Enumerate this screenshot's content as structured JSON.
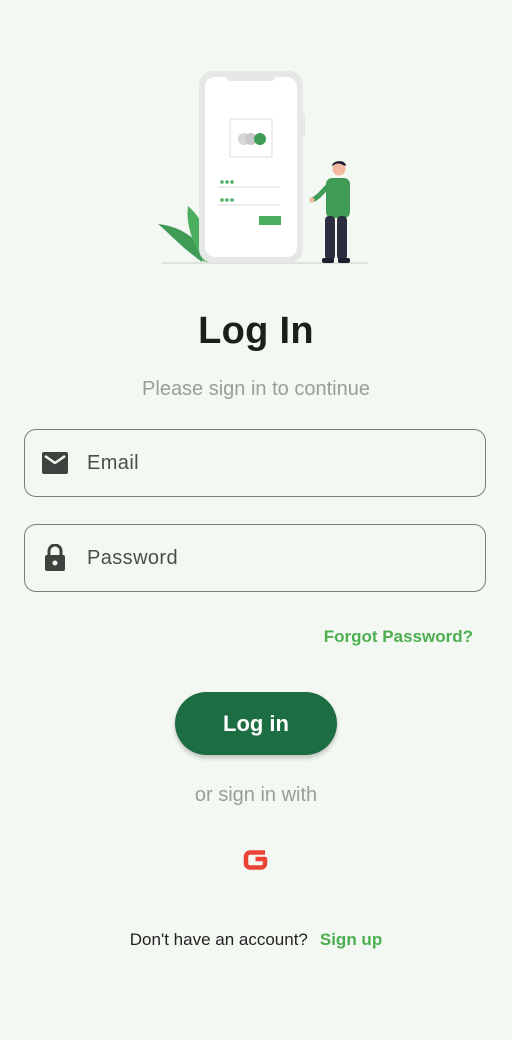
{
  "header": {
    "title": "Log In",
    "subtitle": "Please sign in to continue"
  },
  "form": {
    "email": {
      "placeholder": "Email",
      "value": "",
      "icon": "mail-icon"
    },
    "password": {
      "placeholder": "Password",
      "value": "",
      "icon": "lock-icon"
    },
    "forgot_label": "Forgot Password?",
    "login_label": "Log in"
  },
  "social": {
    "label": "or sign in with",
    "providers": [
      {
        "name": "google-icon"
      }
    ]
  },
  "footer": {
    "question": "Don't have an account?",
    "signup_label": "Sign up"
  },
  "colors": {
    "background": "#f4f8f2",
    "accent": "#4caf50",
    "primary_button": "#1c6e42",
    "google_red": "#ea4335"
  }
}
